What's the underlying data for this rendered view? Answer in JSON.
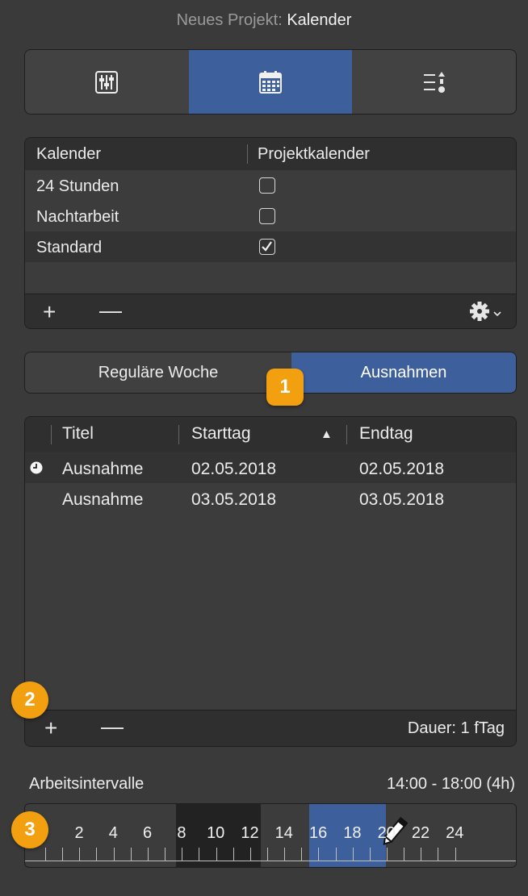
{
  "window": {
    "title_prefix": "Neues Projekt:",
    "title_name": "Kalender"
  },
  "view_tabs": [
    {
      "icon": "sliders-icon",
      "active": false
    },
    {
      "icon": "calendar-icon",
      "active": true
    },
    {
      "icon": "list-sort-icon",
      "active": false
    }
  ],
  "calendars": {
    "columns": [
      "Kalender",
      "Projektkalender"
    ],
    "rows": [
      {
        "name": "24 Stunden",
        "checked": false
      },
      {
        "name": "Nachtarbeit",
        "checked": false
      },
      {
        "name": "Standard",
        "checked": true
      }
    ],
    "add_label": "+",
    "remove_label": "—",
    "gear_icon": "gear-icon"
  },
  "week_toggle": {
    "regular_label": "Reguläre Woche",
    "exceptions_label": "Ausnahmen",
    "active": "exceptions"
  },
  "exceptions": {
    "columns": [
      "Titel",
      "Starttag",
      "Endtag"
    ],
    "sort_indicator": "▲",
    "rows": [
      {
        "title": "Ausnahme",
        "start": "02.05.2018",
        "end": "02.05.2018",
        "has_clock": true
      },
      {
        "title": "Ausnahme",
        "start": "03.05.2018",
        "end": "03.05.2018",
        "has_clock": false
      }
    ],
    "add_label": "+",
    "remove_label": "—",
    "duration": "Dauer: 1 fTag"
  },
  "work_intervals": {
    "label": "Arbeitsintervalle",
    "range": "14:00 - 18:00 (4h)",
    "hours": [
      "2",
      "4",
      "6",
      "8",
      "10",
      "12",
      "14",
      "16",
      "18",
      "20",
      "22",
      "24"
    ]
  },
  "badges": [
    "1",
    "2",
    "3"
  ],
  "colors": {
    "accent": "#3d5f9c",
    "badge": "#f2a00f",
    "background": "#3a3a3a"
  }
}
